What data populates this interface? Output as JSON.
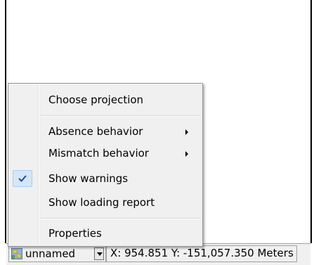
{
  "context_menu": {
    "items": [
      {
        "label": "Choose projection",
        "has_submenu": false,
        "checked": false
      },
      {
        "label": "Absence behavior",
        "has_submenu": true,
        "checked": false
      },
      {
        "label": "Mismatch behavior",
        "has_submenu": true,
        "checked": false
      },
      {
        "label": "Show warnings",
        "has_submenu": false,
        "checked": true
      },
      {
        "label": "Show loading report",
        "has_submenu": false,
        "checked": false
      },
      {
        "label": "Properties",
        "has_submenu": false,
        "checked": false
      }
    ],
    "check_color": "#1a4fa0",
    "highlight_color": "#d5e6f7"
  },
  "statusbar": {
    "projection_label": "unnamed",
    "projection_icon": "globe-icon",
    "dropdown_icon": "chevron-down-icon",
    "coordinates": "X: 954.851 Y: -151,057.350 Meters"
  }
}
